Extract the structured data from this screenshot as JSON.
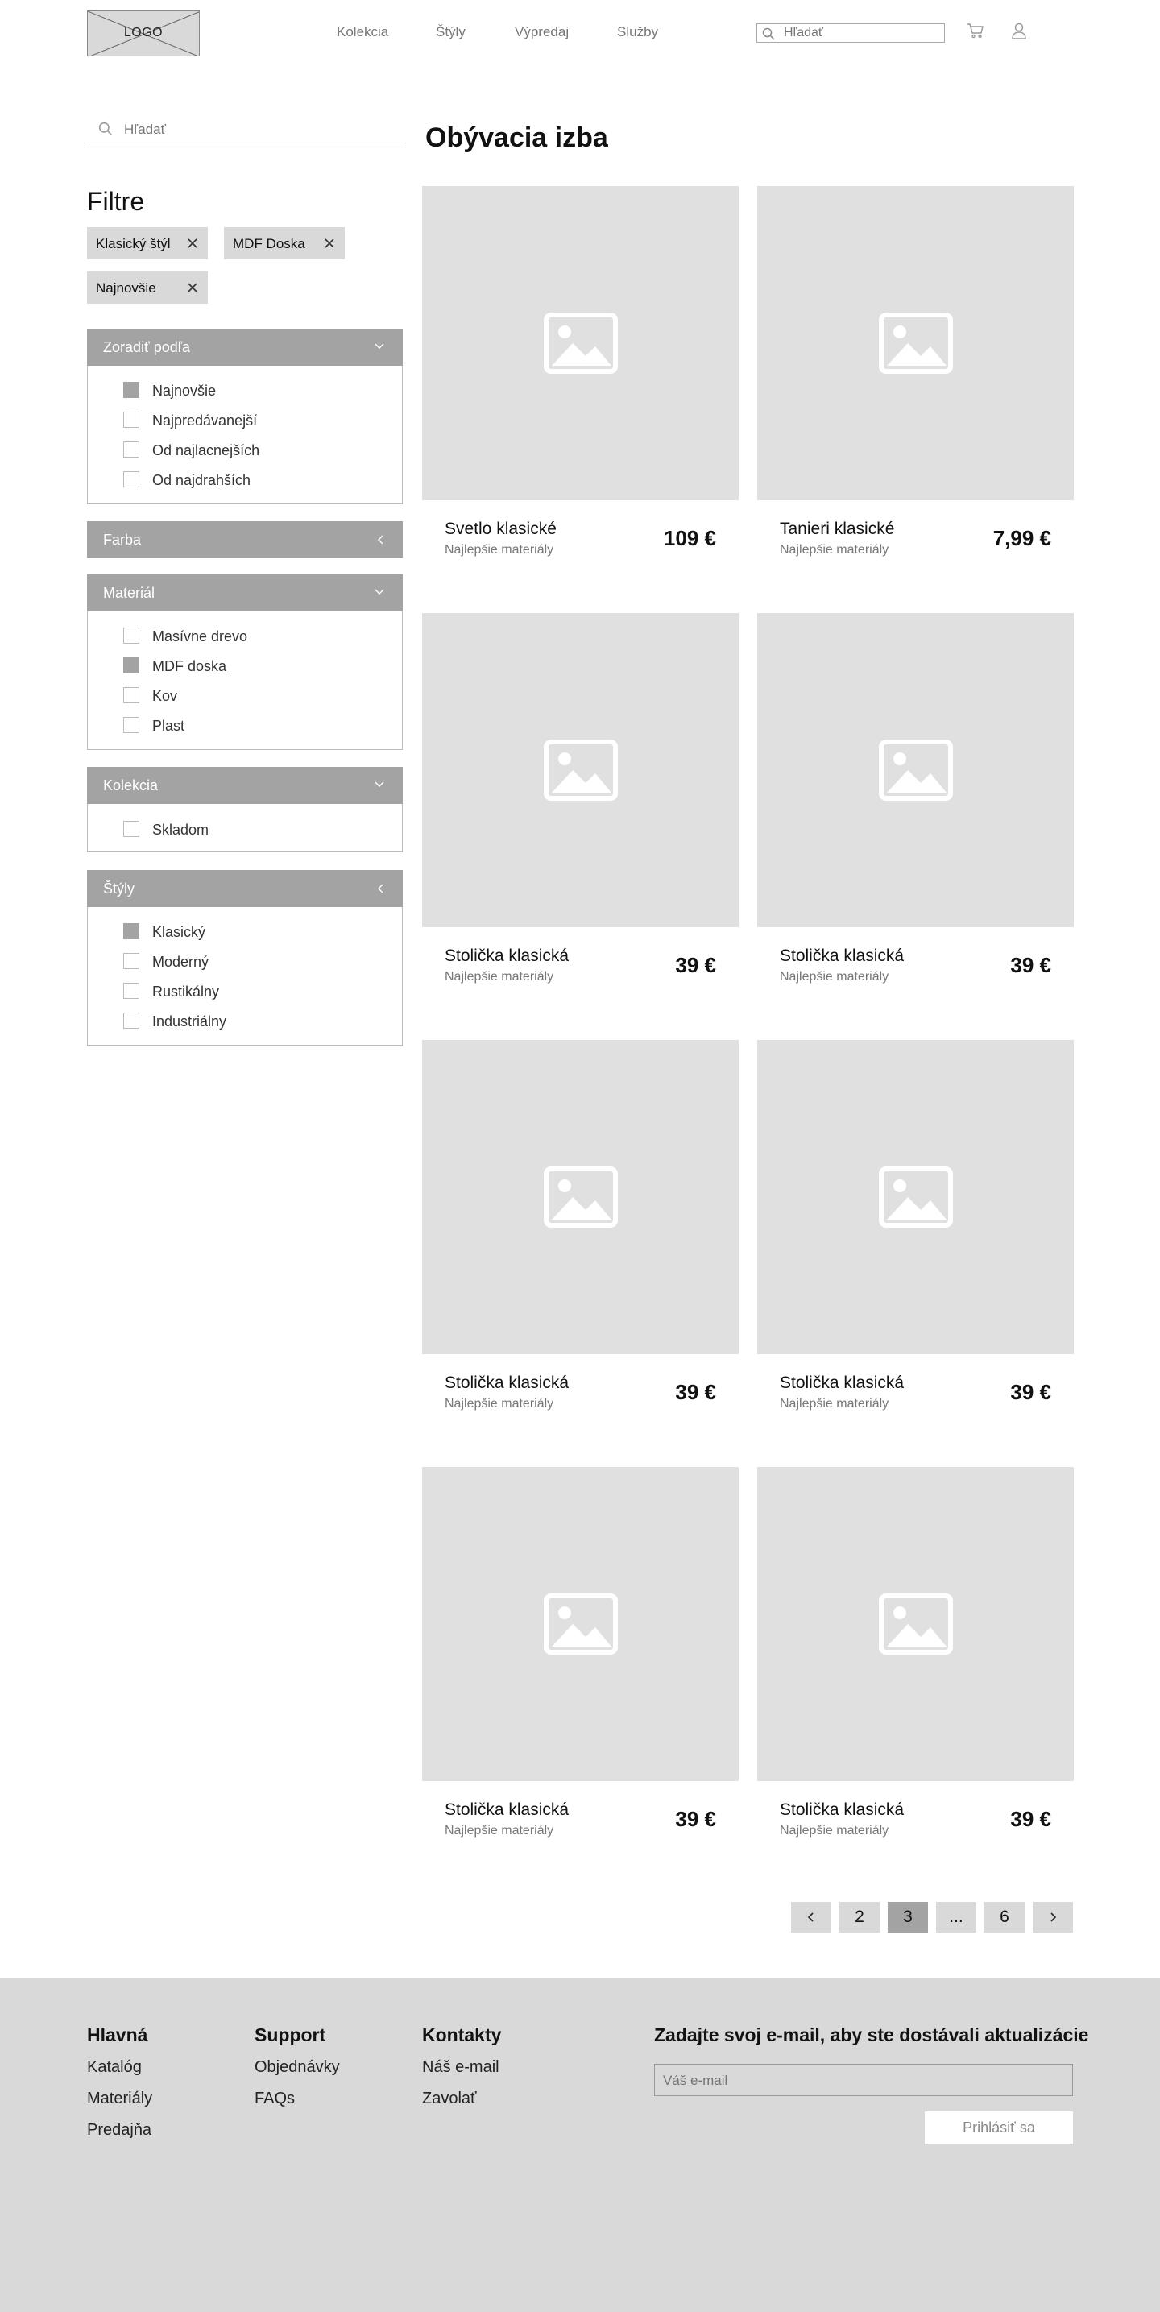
{
  "header": {
    "logo_text": "LOGO",
    "nav": [
      "Kolekcia",
      "Štýly",
      "Výpredaj",
      "Služby"
    ],
    "search_placeholder": "Hľadať"
  },
  "sidebar": {
    "search_placeholder": "Hľadať",
    "filters_title": "Filtre",
    "active_filters": [
      "Klasický štýl",
      "MDF Doska",
      "Najnovšie"
    ],
    "groups": [
      {
        "title": "Zoradiť podľa",
        "expanded": true,
        "options": [
          {
            "label": "Najnovšie",
            "checked": true
          },
          {
            "label": "Najpredávanejší",
            "checked": false
          },
          {
            "label": "Od najlacnejších",
            "checked": false
          },
          {
            "label": "Od najdrahších",
            "checked": false
          }
        ]
      },
      {
        "title": "Farba",
        "expanded": false,
        "options": []
      },
      {
        "title": "Materiál",
        "expanded": true,
        "options": [
          {
            "label": "Masívne drevo",
            "checked": false
          },
          {
            "label": "MDF doska",
            "checked": true
          },
          {
            "label": "Kov",
            "checked": false
          },
          {
            "label": "Plast",
            "checked": false
          }
        ]
      },
      {
        "title": "Kolekcia",
        "expanded": true,
        "options": [
          {
            "label": "Skladom",
            "checked": false
          }
        ]
      },
      {
        "title": "Štýly",
        "expanded": false,
        "options": [
          {
            "label": "Klasický",
            "checked": true
          },
          {
            "label": "Moderný",
            "checked": false
          },
          {
            "label": "Rustikálny",
            "checked": false
          },
          {
            "label": "Industriálny",
            "checked": false
          }
        ]
      }
    ]
  },
  "main": {
    "title": "Obývacia izba",
    "products": [
      {
        "name": "Svetlo klasické",
        "subtitle": "Najlepšie materiály",
        "price": "109 €"
      },
      {
        "name": "Tanieri klasické",
        "subtitle": "Najlepšie materiály",
        "price": "7,99 €"
      },
      {
        "name": "Stolička klasická",
        "subtitle": "Najlepšie materiály",
        "price": "39 €"
      },
      {
        "name": "Stolička klasická",
        "subtitle": "Najlepšie materiály",
        "price": "39 €"
      },
      {
        "name": "Stolička klasická",
        "subtitle": "Najlepšie materiály",
        "price": "39 €"
      },
      {
        "name": "Stolička klasická",
        "subtitle": "Najlepšie materiály",
        "price": "39 €"
      },
      {
        "name": "Stolička klasická",
        "subtitle": "Najlepšie materiály",
        "price": "39 €"
      },
      {
        "name": "Stolička klasická",
        "subtitle": "Najlepšie materiály",
        "price": "39 €"
      }
    ],
    "pagination": {
      "pages": [
        "2",
        "3",
        "...",
        "6"
      ],
      "current": "3"
    }
  },
  "footer": {
    "columns": [
      {
        "title": "Hlavná",
        "links": [
          "Katalóg",
          "Materiály",
          "Predajňa"
        ]
      },
      {
        "title": "Support",
        "links": [
          "Objednávky",
          "FAQs"
        ]
      },
      {
        "title": "Kontakty",
        "links": [
          "Náš e-mail",
          "Zavolať"
        ]
      }
    ],
    "newsletter": {
      "title": "Zadajte svoj e-mail, aby ste dostávali aktualizácie",
      "placeholder": "Váš e-mail",
      "button": "Prihlásiť sa"
    }
  },
  "colors": {
    "panel_header": "#a3a3a3",
    "placeholder_bg": "#e0e0e0",
    "chip_bg": "#d9d9d9",
    "footer_bg": "#d9d9d9"
  }
}
